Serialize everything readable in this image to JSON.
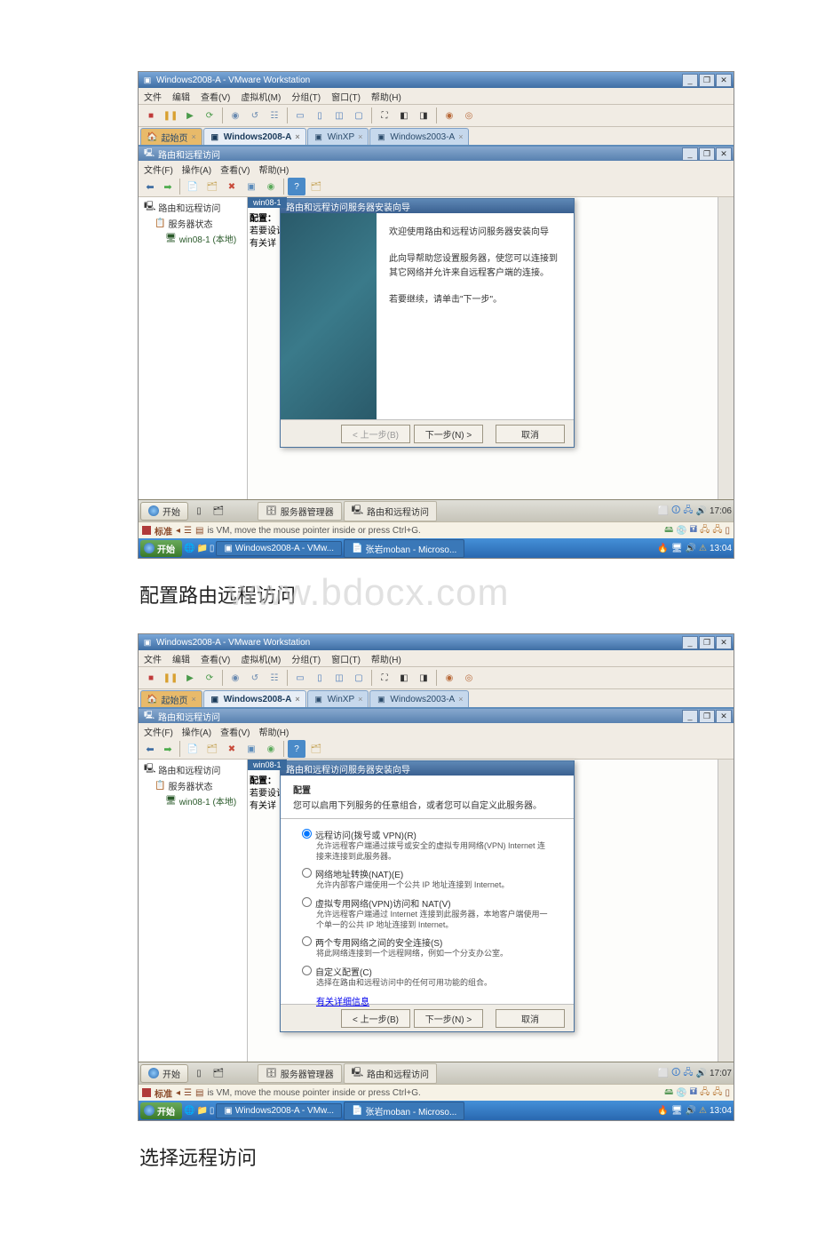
{
  "vmware": {
    "title": "Windows2008-A - VMware Workstation",
    "menu": [
      "文件",
      "编辑",
      "查看(V)",
      "虚拟机(M)",
      "分组(T)",
      "窗口(T)",
      "帮助(H)"
    ],
    "tabs": [
      {
        "label": "起始页"
      },
      {
        "label": "Windows2008-A",
        "active": true
      },
      {
        "label": "WinXP"
      },
      {
        "label": "Windows2003-A"
      }
    ]
  },
  "guest": {
    "title": "路由和远程访问",
    "menu": [
      "文件(F)",
      "操作(A)",
      "查看(V)",
      "帮助(H)"
    ],
    "tree": {
      "root": "路由和远程访问",
      "server_status": "服务器状态",
      "node": "win08-1 (本地)"
    },
    "winlabel": "win08-1",
    "config_text": {
      "l1": "配置：",
      "l2": "若要设计",
      "l3": "有关详"
    },
    "taskbar": {
      "start": "开始",
      "task1": "服务器管理器",
      "task2": "路由和远程访问",
      "time1": "17:06",
      "time2": "17:07"
    }
  },
  "wizard1": {
    "title": "路由和远程访问服务器安装向导",
    "welcome": "欢迎使用路由和远程访问服务器安装向导",
    "desc1": "此向导帮助您设置服务器，使您可以连接到其它网络并允许来自远程客户端的连接。",
    "desc2": "若要继续，请单击\"下一步\"。",
    "back": "< 上一步(B)",
    "next": "下一步(N) >",
    "cancel": "取消"
  },
  "wizard2": {
    "title": "路由和远程访问服务器安装向导",
    "header": "配置",
    "subheader": "您可以启用下列服务的任意组合，或者您可以自定义此服务器。",
    "opt1": {
      "label": "远程访问(拨号或 VPN)(R)",
      "desc": "允许远程客户端通过拨号或安全的虚拟专用网络(VPN) Internet 连接来连接到此服务器。"
    },
    "opt2": {
      "label": "网络地址转换(NAT)(E)",
      "desc": "允许内部客户端使用一个公共 IP 地址连接到 Internet。"
    },
    "opt3": {
      "label": "虚拟专用网络(VPN)访问和 NAT(V)",
      "desc": "允许远程客户端通过 Internet 连接到此服务器，本地客户端使用一个单一的公共 IP 地址连接到 Internet。"
    },
    "opt4": {
      "label": "两个专用网络之间的安全连接(S)",
      "desc": "将此网络连接到一个远程网络，例如一个分支办公室。"
    },
    "opt5": {
      "label": "自定义配置(C)",
      "desc": "选择在路由和远程访问中的任何可用功能的组合。"
    },
    "more": "有关详细信息",
    "back": "< 上一步(B)",
    "next": "下一步(N) >",
    "cancel": "取消"
  },
  "status": {
    "left_label": "标准",
    "hint": "is VM, move the mouse pointer inside or press Ctrl+G."
  },
  "host_taskbar": {
    "start": "开始",
    "task1": "Windows2008-A - VMw...",
    "task2": "张岩moban - Microso...",
    "time": "13:04"
  },
  "captions": {
    "c1": "配置路由远程访问",
    "c2": "选择远程访问"
  },
  "watermark": "www.bdocx.com"
}
